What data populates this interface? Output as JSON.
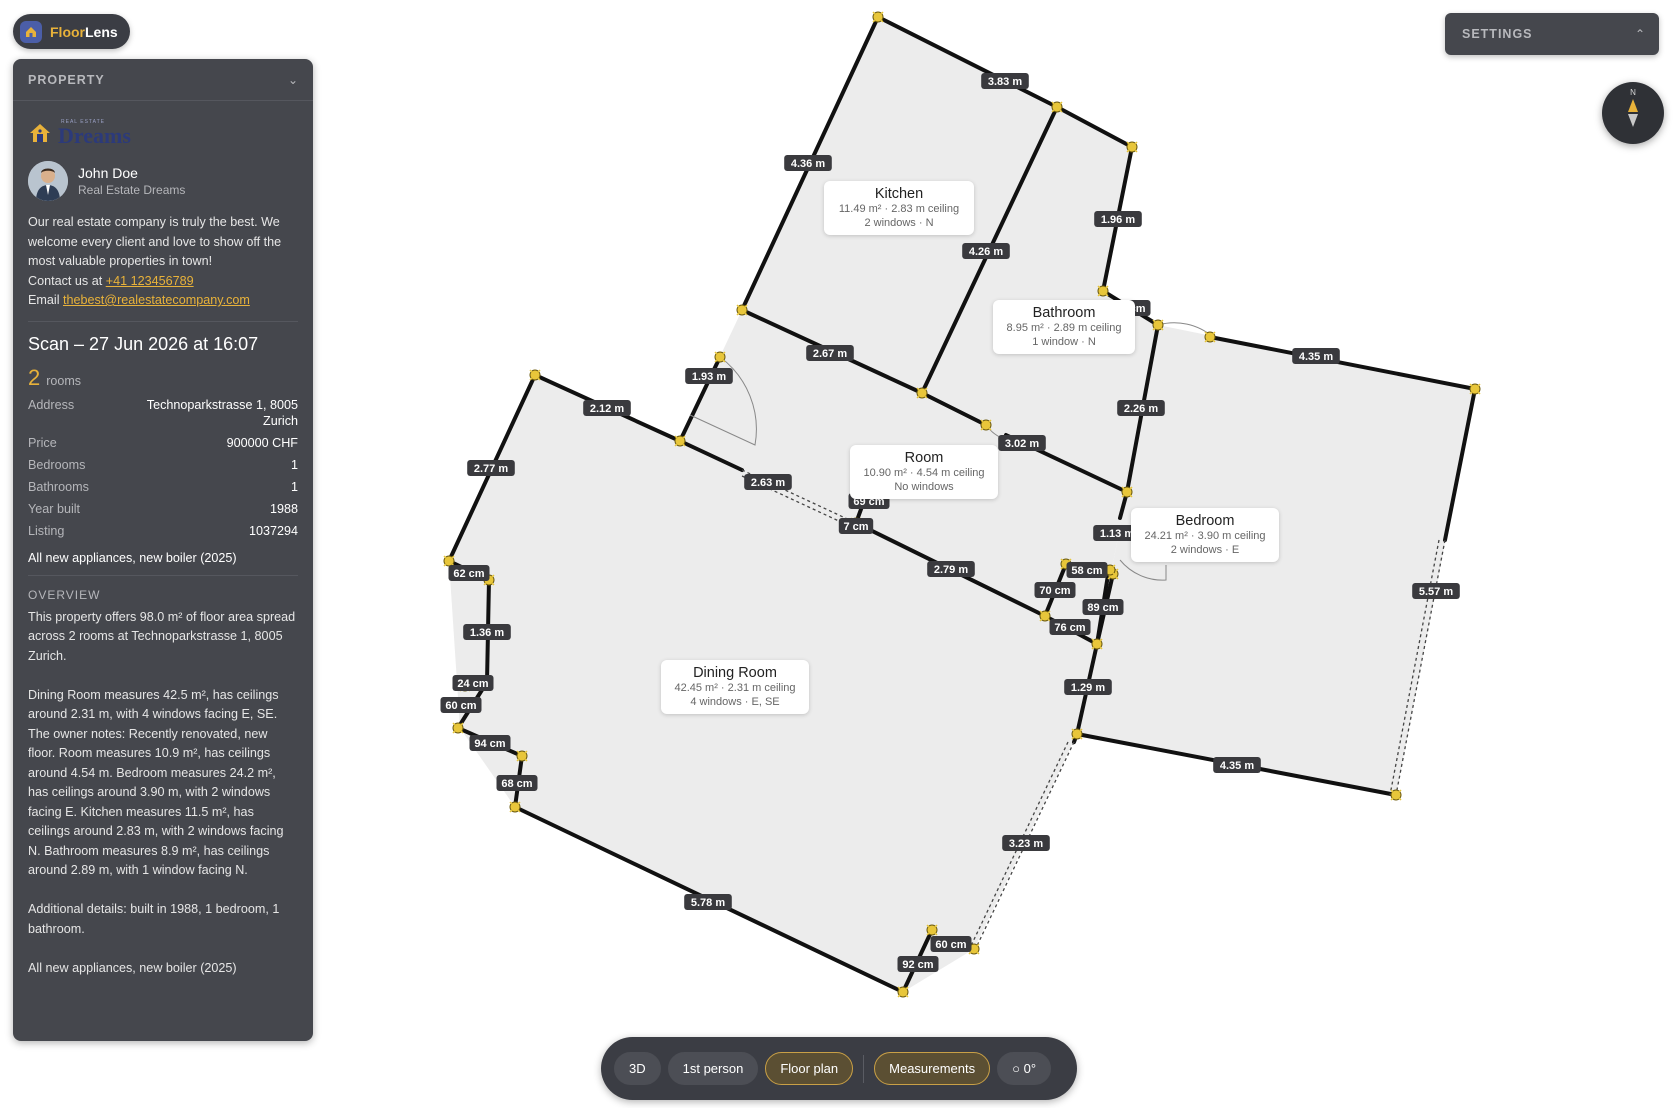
{
  "app": {
    "name_part1": "Floor",
    "name_part2": "Lens"
  },
  "property_panel": {
    "header": "PROPERTY",
    "company_small": "REAL ESTATE",
    "company_name": "Dreams",
    "agent_name": "John Doe",
    "agent_company": "Real Estate Dreams",
    "bio_text": "Our real estate company is truly the best. We welcome every client and love to show off the most valuable properties in town!",
    "contact_prefix": "Contact us at",
    "phone": "+41 123456789",
    "email_prefix": "Email",
    "email": "thebest@realestatecompany.com",
    "scan_title": "Scan – 27 Jun 2026 at 16:07",
    "rooms_count": "2",
    "rooms_label": "rooms",
    "details": [
      {
        "label": "Address",
        "value": "Technoparkstrasse 1, 8005 Zurich"
      },
      {
        "label": "Price",
        "value": "900000 CHF"
      },
      {
        "label": "Bedrooms",
        "value": "1"
      },
      {
        "label": "Bathrooms",
        "value": "1"
      },
      {
        "label": "Year built",
        "value": "1988"
      },
      {
        "label": "Listing",
        "value": "1037294"
      }
    ],
    "note": "All new appliances, new boiler (2025)",
    "overview_title": "OVERVIEW",
    "overview_text": "This property offers 98.0 m² of floor area spread across 2 rooms at Technoparkstrasse 1, 8005 Zurich.\n\nDining Room measures 42.5 m², has ceilings around 2.31 m, with 4 windows facing E, SE. The owner notes: Recently renovated, new floor. Room measures 10.9 m², has ceilings around 4.54 m. Bedroom measures 24.2 m², has ceilings around 3.90 m, with 2 windows facing E. Kitchen measures 11.5 m², has ceilings around 2.83 m, with 2 windows facing N. Bathroom measures 8.9 m², has ceilings around 2.89 m, with 1 window facing N.\n\nAdditional details: built in 1988, 1 bedroom, 1 bathroom.\n\nAll new appliances, new boiler (2025)"
  },
  "settings": {
    "label": "SETTINGS"
  },
  "compass": {
    "north_label": "N"
  },
  "toolbar": {
    "view_3d": "3D",
    "view_first_person": "1st person",
    "view_floor_plan": "Floor plan",
    "measurements": "Measurements",
    "rotation": "○ 0°",
    "active_view": "Floor plan"
  },
  "rooms": [
    {
      "name": "Kitchen",
      "info1": "11.49 m² · 2.83 m ceiling",
      "info2": "2 windows · N"
    },
    {
      "name": "Bathroom",
      "info1": "8.95 m² · 2.89 m ceiling",
      "info2": "1 window · N"
    },
    {
      "name": "Room",
      "info1": "10.90 m² · 4.54 m ceiling",
      "info2": "No windows"
    },
    {
      "name": "Bedroom",
      "info1": "24.21 m² · 3.90 m ceiling",
      "info2": "2 windows · E"
    },
    {
      "name": "Dining Room",
      "info1": "42.45 m² · 2.31 m ceiling",
      "info2": "4 windows · E, SE"
    }
  ],
  "measurements": [
    "3.83 m",
    "4.36 m",
    "1.96 m",
    "4.26 m",
    "84 cm",
    "4.35 m",
    "1.93 m",
    "2.67 m",
    "2.12 m",
    "2.77 m",
    "3.02 m",
    "2.26 m",
    "2.63 m",
    "69 cm",
    "7 cm",
    "1.13 m",
    "2.79 m",
    "58 cm",
    "70 cm",
    "89 cm",
    "76 cm",
    "62 cm",
    "1.36 m",
    "24 cm",
    "60 cm",
    "94 cm",
    "68 cm",
    "1.29 m",
    "5.57 m",
    "4.35 m",
    "3.23 m",
    "5.78 m",
    "60 cm",
    "92 cm"
  ]
}
